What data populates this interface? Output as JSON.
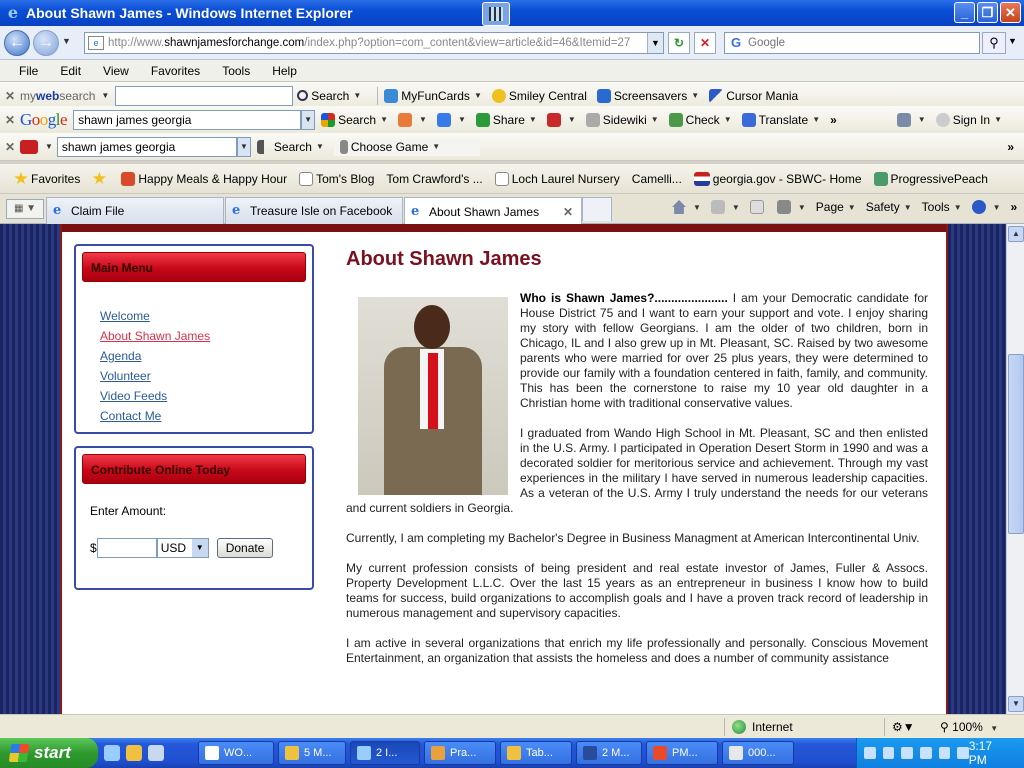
{
  "window": {
    "title": "About Shawn James - Windows Internet Explorer",
    "min": "_",
    "max": "❐",
    "close": "✕"
  },
  "address": {
    "url_prefix": "http://www.",
    "url_domain": "shawnjamesforchange.com",
    "url_rest": "/index.php?option=com_content&view=article&id=46&Itemid=27",
    "search_placeholder": "Google"
  },
  "menubar": [
    "File",
    "Edit",
    "View",
    "Favorites",
    "Tools",
    "Help"
  ],
  "toolbar1": {
    "brand_prefix": "my",
    "brand_bold": "web",
    "brand_suffix": "search",
    "search_label": "Search",
    "items": [
      "MyFunCards",
      "Smiley Central",
      "Screensavers",
      "Cursor Mania"
    ]
  },
  "toolbar2": {
    "query": "shawn james georgia",
    "search_label": "Search",
    "share": "Share",
    "sidewiki": "Sidewiki",
    "check": "Check",
    "translate": "Translate",
    "signin": "Sign In"
  },
  "toolbar3": {
    "query": "shawn james georgia",
    "search_label": "Search",
    "game_label": "Choose Game"
  },
  "favorites": {
    "label": "Favorites",
    "items": [
      "Happy Meals & Happy Hour",
      "Tom's Blog",
      "Tom Crawford's ...",
      "Loch Laurel Nursery",
      "Camelli...",
      "georgia.gov - SBWC- Home",
      "ProgressivePeach"
    ]
  },
  "tabs": {
    "items": [
      "Claim File",
      "Treasure Isle on Facebook",
      "About Shawn James"
    ],
    "close": "✕"
  },
  "commandbar": {
    "page": "Page",
    "safety": "Safety",
    "tools": "Tools"
  },
  "sidebar": {
    "menu_title": "Main Menu",
    "menu_items": [
      "Welcome",
      "About Shawn James",
      "Agenda",
      "Volunteer",
      "Video Feeds",
      "Contact Me"
    ],
    "contribute_title": "Contribute Online Today",
    "amount_label": "Enter Amount:",
    "currency_symbol": "$",
    "currency": "USD",
    "donate_label": "Donate"
  },
  "article": {
    "title": "About Shawn James",
    "p1_bold": "Who is  Shawn James?......................",
    "p1": " I am your Democratic candidate for House District 75 and I want to earn your support and vote. I enjoy sharing my story with fellow Georgians. I am the older of two children, born in Chicago, IL and I also grew up in Mt. Pleasant, SC. Raised by two awesome parents who were married for over 25 plus years, they were determined to provide our family with a foundation centered in faith, family, and community. This has been the cornerstone to raise my 10 year old daughter in a Christian home with traditional conservative values.",
    "p2": "I graduated from Wando High School in Mt. Pleasant, SC and then enlisted in the U.S. Army. I participated in Operation Desert Storm in 1990 and was a decorated soldier for meritorious service and achievement. Through my vast experiences in the military I have served in numerous leadership capacities. As a veteran of the U.S. Army I truly understand the needs for our veterans and current soldiers in Georgia.",
    "p3": "Currently, I am completing my Bachelor's Degree in Business Managment at American Intercontinental Univ.",
    "p4": "My current profession consists of being president and real estate investor of James, Fuller & Assocs. Property Development L.L.C. Over the last 15 years as an entrepreneur in business I  know how to build teams for success, build organizations to accomplish goals and I have a proven track record of leadership in numerous management and supervisory capacities.",
    "p5": "I am active in several organizations that enrich my life professionally and personally. Conscious Movement Entertainment, an organization that assists the homeless and does a number of community assistance"
  },
  "status": {
    "zone": "Internet",
    "zoom": "100%"
  },
  "taskbar": {
    "start": "start",
    "tasks": [
      "WO...",
      "5 M...",
      "2 I...",
      "Pra...",
      "Tab...",
      "2 M...",
      "PM...",
      "000..."
    ],
    "clock": "3:17 PM"
  }
}
